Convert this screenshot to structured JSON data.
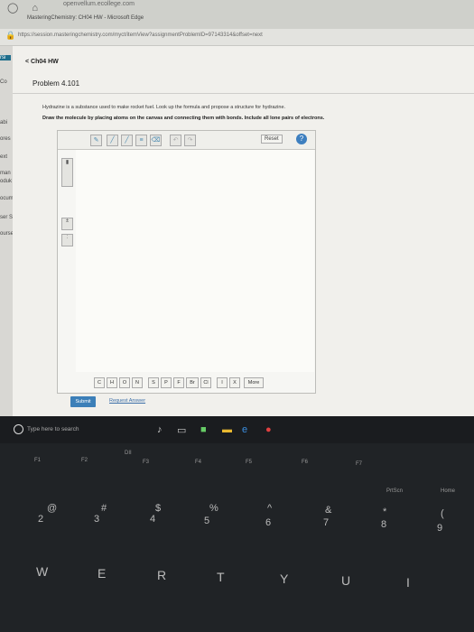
{
  "browser": {
    "tab_title": "openvellum.ecollege.com",
    "window_title": "MasteringChemistry: CH04 HW - Microsoft Edge",
    "url": "https://session.masteringchemistry.com/myct/itemView?assignmentProblemID=97143314&offset=next"
  },
  "leftnav": {
    "items": [
      "rsi",
      "Co",
      "abi",
      "ores",
      "ext",
      "man",
      "oduk",
      "ocum",
      "ser S",
      "ourse"
    ]
  },
  "header": {
    "back_label": "< Ch04 HW",
    "problem_title": "Problem 4.101"
  },
  "problem": {
    "intro": "Hydrazine is a substance used to make rocket fuel. Look up the formula and propose a structure for hydrazine.",
    "instruction": "Draw the molecule by placing atoms on the canvas and connecting them with bonds. Include all lone pairs of electrons."
  },
  "editor": {
    "reset_label": "Reset",
    "help_label": "?",
    "atoms": [
      "C",
      "H",
      "O",
      "N",
      "S",
      "P",
      "F",
      "Br",
      "Cl",
      "I",
      "X",
      "More"
    ]
  },
  "actions": {
    "submit_label": "Submit",
    "request_label": "Request Answer"
  },
  "taskbar": {
    "search_placeholder": "Type here to search"
  },
  "keyboard": {
    "fkeys": [
      "F1",
      "F2",
      "DII",
      "F3",
      "F4",
      "F5",
      "F6",
      "F7",
      "PrtScn",
      "Home"
    ],
    "numkeys": [
      "@",
      "2",
      "#",
      "3",
      "$",
      "4",
      "%",
      "5",
      "^",
      "6",
      "&",
      "7",
      "*",
      "8",
      "(",
      "9"
    ],
    "letters": [
      "W",
      "E",
      "R",
      "T",
      "Y",
      "U",
      "I"
    ]
  }
}
